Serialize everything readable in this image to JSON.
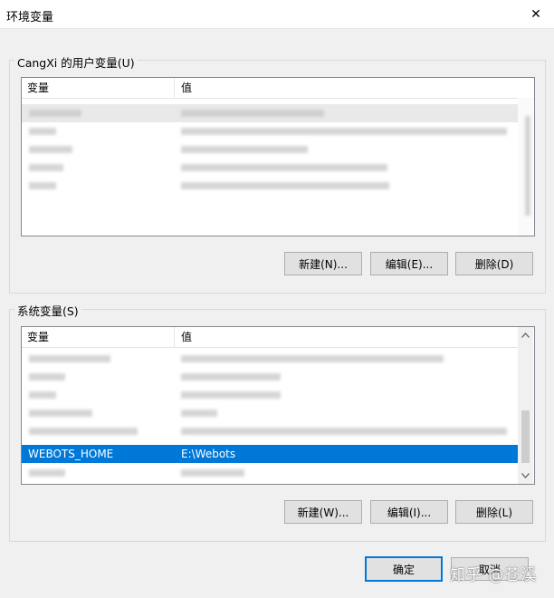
{
  "window": {
    "title": "环境变量",
    "close_glyph": "✕"
  },
  "user_vars": {
    "group_label": "CangXi 的用户变量(U)",
    "columns": [
      "变量",
      "值"
    ],
    "buttons": {
      "new": "新建(N)...",
      "edit": "编辑(E)...",
      "delete": "删除(D)"
    }
  },
  "system_vars": {
    "group_label": "系统变量(S)",
    "columns": [
      "变量",
      "值"
    ],
    "selected_row": {
      "name": "WEBOTS_HOME",
      "value": "E:\\Webots"
    },
    "buttons": {
      "new": "新建(W)...",
      "edit": "编辑(I)...",
      "delete": "删除(L)"
    }
  },
  "footer": {
    "ok": "确定",
    "cancel": "取消"
  },
  "watermark": "知乎 @苍溪",
  "colors": {
    "selection": "#0078d7",
    "default_button_border": "#0078d7"
  }
}
